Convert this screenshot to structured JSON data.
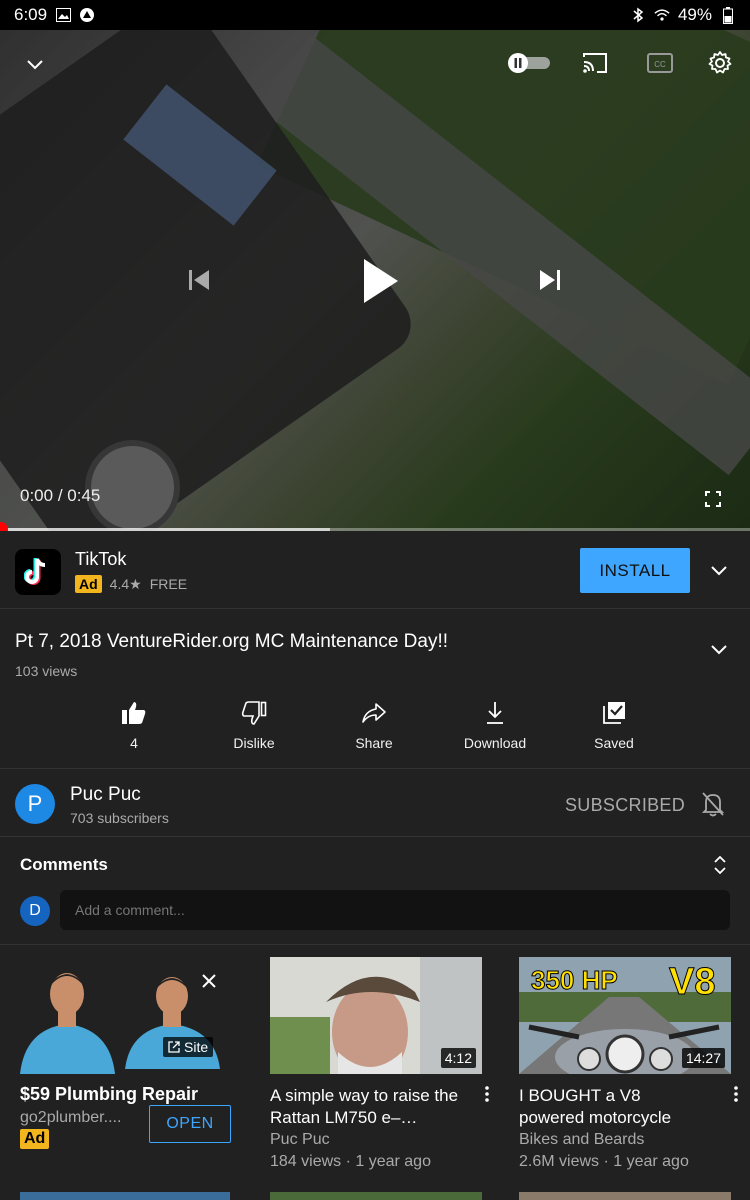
{
  "status_bar": {
    "time": "6:09",
    "battery": "49%"
  },
  "player": {
    "current_time": "0:00",
    "duration": "0:45",
    "time_separator": " / ",
    "progress": 0.0,
    "buffered": 0.44
  },
  "ad_banner": {
    "app_name": "TikTok",
    "ad_badge": "Ad",
    "rating": "4.4",
    "price": "FREE",
    "install_label": "INSTALL"
  },
  "video": {
    "title": "Pt 7, 2018 VentureRider.org MC Maintenance Day!!",
    "views": "103 views"
  },
  "actions": [
    {
      "label": "4",
      "icon": "thumbs-up-icon"
    },
    {
      "label": "Dislike",
      "icon": "thumbs-down-icon"
    },
    {
      "label": "Share",
      "icon": "share-icon"
    },
    {
      "label": "Download",
      "icon": "download-icon"
    },
    {
      "label": "Saved",
      "icon": "saved-icon"
    }
  ],
  "channel": {
    "avatar_letter": "P",
    "name": "Puc Puc",
    "subscribers": "703 subscribers",
    "subscribed_label": "SUBSCRIBED"
  },
  "comments": {
    "title": "Comments",
    "avatar_letter": "D",
    "placeholder": "Add a comment..."
  },
  "promo_ad": {
    "title": "$59 Plumbing Repair",
    "url": "go2plumber....",
    "badge": "Ad",
    "site_label": "Site",
    "open_label": "OPEN"
  },
  "recommended": [
    {
      "title": "A simple way to raise the Rattan LM750 e–…",
      "channel": "Puc Puc",
      "meta": "184 views · 1 year ago",
      "duration": "4:12"
    },
    {
      "title": "I BOUGHT a V8 powered motorcycle",
      "channel": "Bikes and Beards",
      "meta": "2.6M views · 1 year ago",
      "duration": "14:27",
      "thumb_text_left": "350 HP",
      "thumb_text_right": "V8"
    }
  ],
  "colors": {
    "accent": "#3ea6ff",
    "ad_badge": "#f2b51d",
    "progress": "#ff0000",
    "background": "#212121"
  }
}
